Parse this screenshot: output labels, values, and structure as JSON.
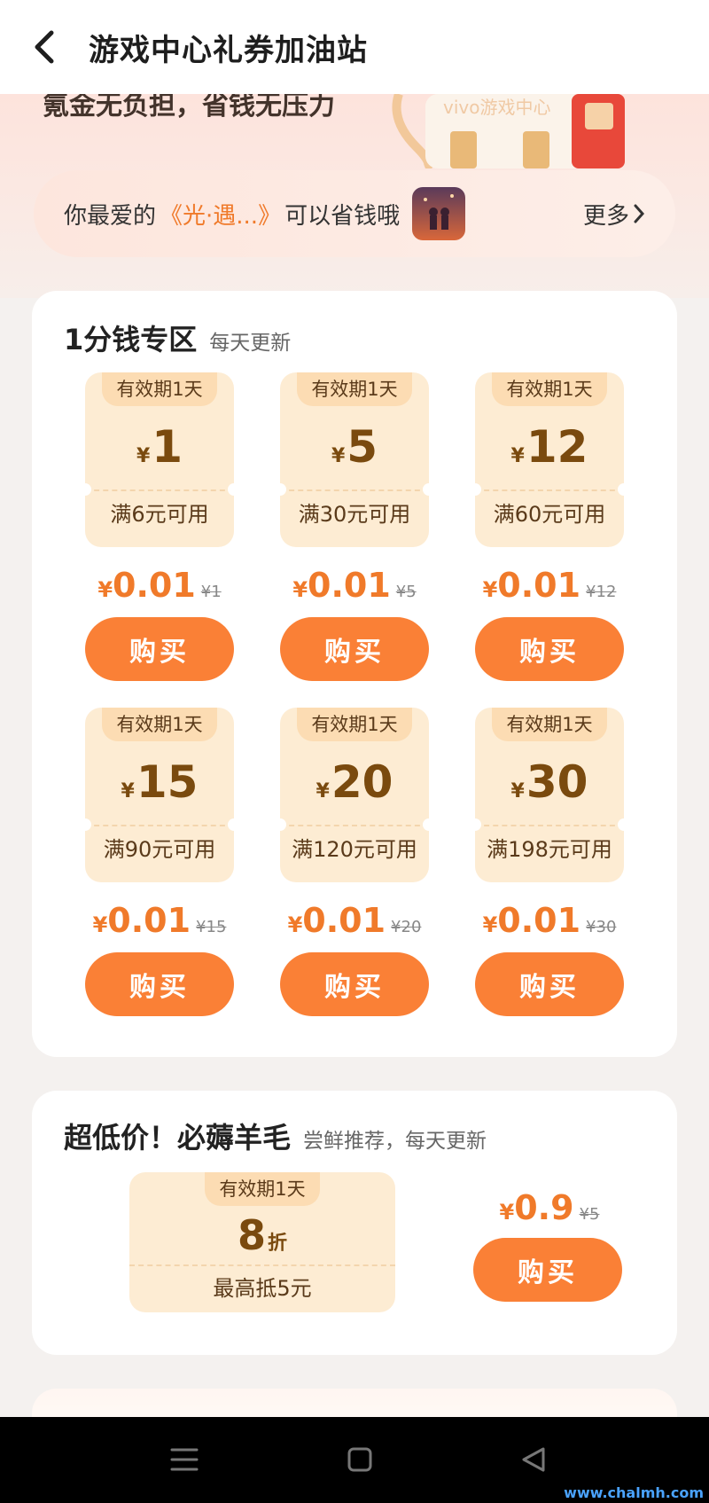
{
  "header": {
    "title": "游戏中心礼券加油站"
  },
  "banner": {
    "slogan": "氪金无负担，省钱无压力",
    "art_text": "vivo游戏中心",
    "rec_prefix": "你最爱的",
    "rec_game": "《光·遇...》",
    "rec_suffix": "可以省钱哦",
    "more_label": "更多"
  },
  "penny_zone": {
    "title": "1分钱专区",
    "subtitle": "每天更新",
    "coupons": [
      {
        "tag": "有效期1天",
        "amount": "1",
        "condition": "满6元可用",
        "price": "0.01",
        "original": "¥1",
        "buy": "购买"
      },
      {
        "tag": "有效期1天",
        "amount": "5",
        "condition": "满30元可用",
        "price": "0.01",
        "original": "¥5",
        "buy": "购买"
      },
      {
        "tag": "有效期1天",
        "amount": "12",
        "condition": "满60元可用",
        "price": "0.01",
        "original": "¥12",
        "buy": "购买"
      },
      {
        "tag": "有效期1天",
        "amount": "15",
        "condition": "满90元可用",
        "price": "0.01",
        "original": "¥15",
        "buy": "购买"
      },
      {
        "tag": "有效期1天",
        "amount": "20",
        "condition": "满120元可用",
        "price": "0.01",
        "original": "¥20",
        "buy": "购买"
      },
      {
        "tag": "有效期1天",
        "amount": "30",
        "condition": "满198元可用",
        "price": "0.01",
        "original": "¥30",
        "buy": "购买"
      }
    ]
  },
  "bargain": {
    "title": "超低价！必薅羊毛",
    "subtitle": "尝鲜推荐，每天更新",
    "coupon": {
      "tag": "有效期1天",
      "amount": "8",
      "unit": "折",
      "condition": "最高抵5元"
    },
    "price": "0.9",
    "original": "¥5",
    "buy": "购买"
  },
  "currency_symbol": "¥",
  "watermark": "www.chalmh.com",
  "colors": {
    "accent": "#fa8036",
    "price": "#f07a2a",
    "coupon_bg": "#fdecd3",
    "coupon_text": "#7a4a0e"
  }
}
